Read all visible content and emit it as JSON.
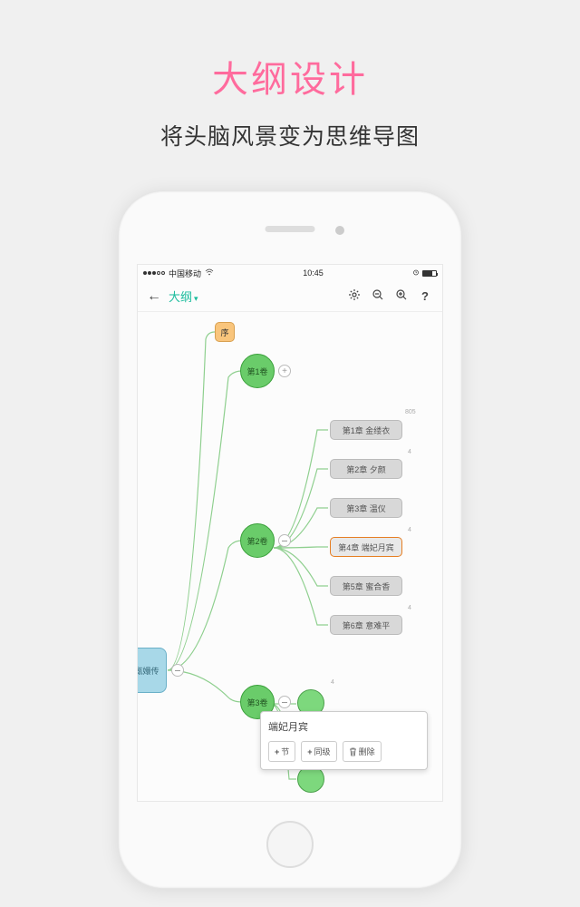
{
  "header": {
    "title": "大纲设计",
    "subtitle": "将头脑风景变为思维导图"
  },
  "status_bar": {
    "carrier": "中国移动",
    "time": "10:45"
  },
  "toolbar": {
    "title": "大纲"
  },
  "nodes": {
    "root": "后宫甄嬛传",
    "preface": "序",
    "volume1": "第1卷",
    "volume2": "第2卷",
    "volume3": "第3卷",
    "chapters": {
      "ch1": "第1章 金缕衣",
      "ch2": "第2章 夕颜",
      "ch3": "第3章 温仪",
      "ch4": "第4章 端妃月宾",
      "ch5": "第5章 蜜合香",
      "ch6": "第6章 意难平"
    },
    "badges": {
      "b805": "805",
      "b4a": "4",
      "b4b": "4",
      "b4c": "4",
      "b4d": "4"
    }
  },
  "popup": {
    "title": "端妃月宾",
    "btn_child": "节",
    "btn_sibling": "同级",
    "btn_delete": "删除"
  }
}
